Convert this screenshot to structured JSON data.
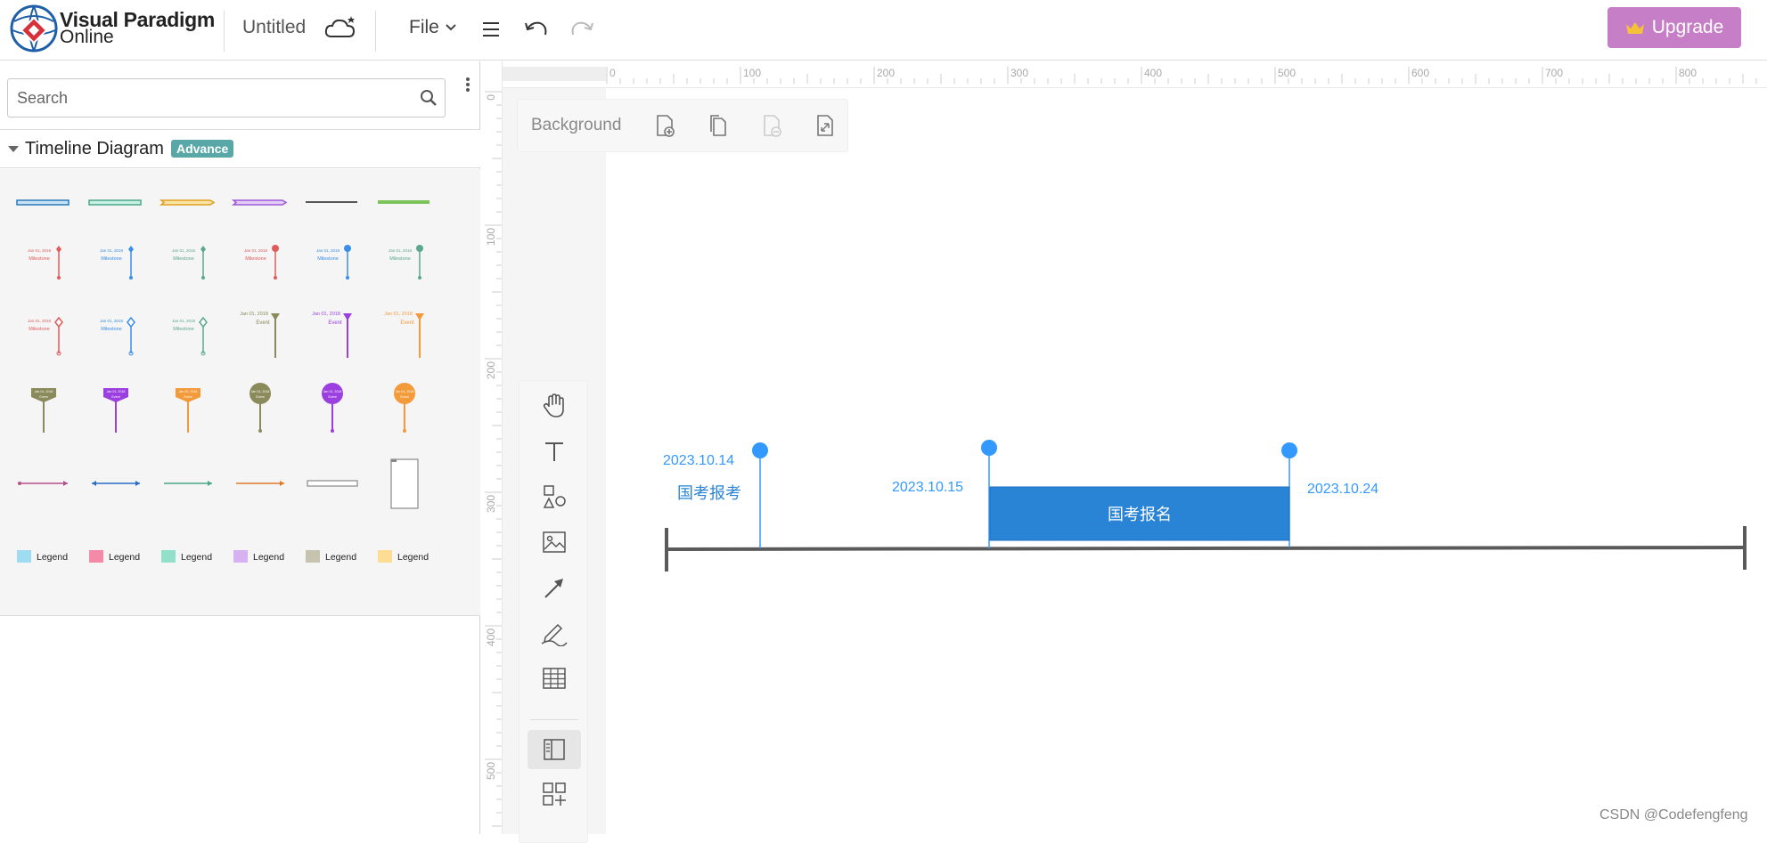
{
  "header": {
    "brand_line1": "Visual Paradigm",
    "brand_line2": "Online",
    "doc_title": "Untitled",
    "file_menu": "File",
    "upgrade_label": "Upgrade",
    "icons": [
      "logo-icon",
      "cloud-icon",
      "menu-icon",
      "undo-icon",
      "redo-icon",
      "crown-icon"
    ]
  },
  "sidebar": {
    "search_placeholder": "Search",
    "category_title": "Timeline Diagram",
    "category_badge": "Advance",
    "milestone_date": "Jan 01, 2018",
    "milestone_label": "Milestone",
    "event_label": "Event",
    "legend_label": "Legend",
    "colors": {
      "red": "#e05b5b",
      "blue": "#3a8ee6",
      "teal": "#5aa88e",
      "olive": "#8a8a5a",
      "purple": "#9b3fe0",
      "orange": "#f39b3a",
      "legend": [
        "#9fdcf2",
        "#f48aa7",
        "#92e0c9",
        "#d7b2f0",
        "#c6c3ae",
        "#fddc94"
      ]
    }
  },
  "canvas": {
    "ruler_h_labels": [
      "0",
      "100",
      "200",
      "300",
      "400",
      "500",
      "600",
      "700",
      "800"
    ],
    "ruler_v_labels": [
      "0",
      "100",
      "200",
      "300",
      "400",
      "500"
    ],
    "background_label": "Background",
    "background_icons": [
      "add-page-icon",
      "duplicate-page-icon",
      "remove-page-icon",
      "fit-page-icon"
    ],
    "tools": [
      "hand-icon",
      "text-icon",
      "shapes-icon",
      "image-icon",
      "connector-icon",
      "pen-icon",
      "table-icon",
      "panel-toggle-icon",
      "add-shapes-icon"
    ]
  },
  "diagram": {
    "milestone1_date": "2023.10.14",
    "milestone1_label": "国考报考",
    "milestone2_date": "2023.10.15",
    "milestone3_date": "2023.10.24",
    "bar_label": "国考报名",
    "accent": "#2a84d6",
    "pin": "#3399ff",
    "axis_color": "#5a5a5a"
  },
  "watermark": "CSDN @Codefengfeng"
}
